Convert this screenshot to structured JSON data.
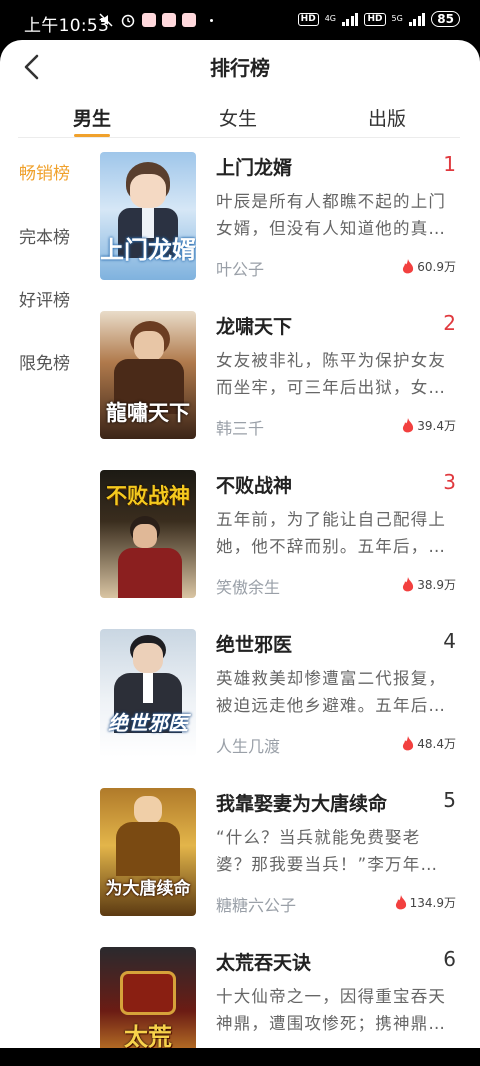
{
  "status": {
    "time": "上午10:53",
    "hd1": "HD",
    "net1": "4G",
    "hd2": "HD",
    "net2": "5G",
    "battery": "85"
  },
  "header": {
    "title": "排行榜"
  },
  "tabs": [
    {
      "label": "男生",
      "active": true
    },
    {
      "label": "女生",
      "active": false
    },
    {
      "label": "出版",
      "active": false
    }
  ],
  "sidebar": {
    "items": [
      {
        "label": "畅销榜",
        "active": true
      },
      {
        "label": "完本榜",
        "active": false
      },
      {
        "label": "好评榜",
        "active": false
      },
      {
        "label": "限免榜",
        "active": false
      }
    ]
  },
  "books": [
    {
      "title": "上门龙婿",
      "rank": "1",
      "desc": "叶辰是所有人都瞧不起的上门女婿，但没有人知道他的真…",
      "author": "叶公子",
      "heat": "60.9万",
      "cover_text": "上门龙婿"
    },
    {
      "title": "龙啸天下",
      "rank": "2",
      "desc": "女友被非礼，陈平为保护女友而坐牢，可三年后出狱，女…",
      "author": "韩三千",
      "heat": "39.4万",
      "cover_text": "龍嘯天下"
    },
    {
      "title": "不败战神",
      "rank": "3",
      "desc": "五年前，为了能让自己配得上她，他不辞而别。五年后，…",
      "author": "笑傲余生",
      "heat": "38.9万",
      "cover_text": "不败战神"
    },
    {
      "title": "绝世邪医",
      "rank": "4",
      "desc": "英雄救美却惨遭富二代报复，被迫远走他乡避难。五年后…",
      "author": "人生几渡",
      "heat": "48.4万",
      "cover_text": "绝世邪医"
    },
    {
      "title": "我靠娶妻为大唐续命",
      "rank": "5",
      "desc": "“什么？当兵就能免费娶老婆？那我要当兵！”李万年转世李…",
      "author": "糖糖六公子",
      "heat": "134.9万",
      "cover_text": "为大唐续命"
    },
    {
      "title": "太荒吞天诀",
      "rank": "6",
      "desc": "十大仙帝之一，因得重宝吞天神鼎，遭围攻惨死；携神鼎…",
      "author": "",
      "heat": "",
      "cover_text": "太荒"
    }
  ],
  "colors": {
    "accent": "#f0a12c",
    "rank_top": "#e0393e",
    "flame": "#f2403f"
  }
}
